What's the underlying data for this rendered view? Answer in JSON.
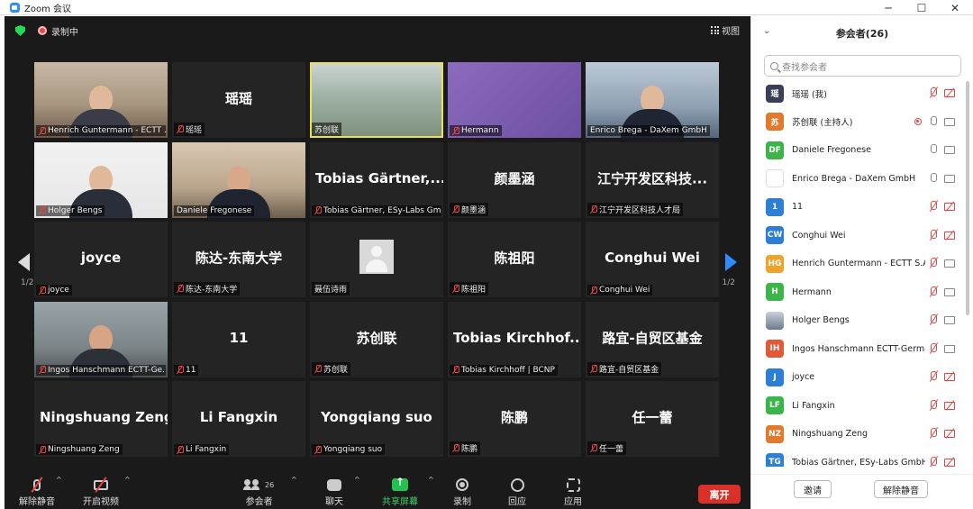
{
  "window": {
    "title": "Zoom 会议",
    "minimize": "─",
    "maximize": "☐",
    "close": "✕"
  },
  "topbar": {
    "recording_label": "录制中",
    "view_label": "视图"
  },
  "colors": {
    "accent": "#2d8cff",
    "leave": "#d9302a",
    "muted": "#e64545",
    "share": "#23c14f"
  },
  "grid": {
    "page_left": "1/2",
    "page_right": "1/2",
    "tiles": [
      {
        "label": "Henrich Guntermann - ECTT ...",
        "display": ""
      },
      {
        "label": "瑶瑶",
        "display": "瑶瑶"
      },
      {
        "label": "苏创联",
        "display": ""
      },
      {
        "label": "Hermann",
        "display": ""
      },
      {
        "label": "Enrico Brega - DaXem GmbH",
        "display": ""
      },
      {
        "label": "Holger Bengs",
        "display": ""
      },
      {
        "label": "Daniele Fregonese",
        "display": ""
      },
      {
        "label": "Tobias Gärtner, ESy-Labs Gm...",
        "display": "Tobias Gärtner,..."
      },
      {
        "label": "颜墨涵",
        "display": "颜墨涵"
      },
      {
        "label": "江宁开发区科技人才局",
        "display": "江宁开发区科技..."
      },
      {
        "label": "joyce",
        "display": "joyce"
      },
      {
        "label": "陈达-东南大学",
        "display": "陈达-东南大学"
      },
      {
        "label": "聂伍诗雨",
        "display": ""
      },
      {
        "label": "陈祖阳",
        "display": "陈祖阳"
      },
      {
        "label": "Conghui Wei",
        "display": "Conghui Wei"
      },
      {
        "label": "Ingos Hanschmann ECTT-Ge...",
        "display": ""
      },
      {
        "label": "11",
        "display": "11"
      },
      {
        "label": "苏创联",
        "display": "苏创联"
      },
      {
        "label": "Tobias Kirchhoff | BCNP",
        "display": "Tobias Kirchhof..."
      },
      {
        "label": "路宜-自贸区基金",
        "display": "路宜-自贸区基金"
      },
      {
        "label": "Ningshuang Zeng",
        "display": "Ningshuang Zeng"
      },
      {
        "label": "Li Fangxin",
        "display": "Li Fangxin"
      },
      {
        "label": "Yongqiang suo",
        "display": "Yongqiang suo"
      },
      {
        "label": "陈鹏",
        "display": "陈鹏"
      },
      {
        "label": "任一蕾",
        "display": "任一蕾"
      }
    ]
  },
  "toolbar": {
    "unmute": "解除静音",
    "start_video": "开启视频",
    "participants": "参会者",
    "participants_count": "26",
    "chat": "聊天",
    "share_screen": "共享屏幕",
    "record": "录制",
    "reactions": "回应",
    "apps": "应用",
    "leave": "离开",
    "caret": "^"
  },
  "panel": {
    "collapse": "⌄",
    "title": "参会者(26)",
    "search_placeholder": "查找参会者",
    "invite": "邀请",
    "unmute_me": "解除静音",
    "participants": [
      {
        "avatar": "瑶",
        "color": "#3a3f55",
        "name": "瑶瑶 (我)",
        "mic": "off",
        "cam": "off",
        "rec": false
      },
      {
        "avatar": "苏",
        "color": "#e07a2e",
        "name": "苏创联 (主持人)",
        "mic": "on",
        "cam": "on",
        "rec": true
      },
      {
        "avatar": "DF",
        "color": "#3bb54a",
        "name": "Daniele Fregonese",
        "mic": "on",
        "cam": "on",
        "rec": false
      },
      {
        "avatar": "",
        "color": "#ffffff",
        "name": "Enrico Brega - DaXem GmbH",
        "mic": "on",
        "cam": "on",
        "rec": false
      },
      {
        "avatar": "1",
        "color": "#2d7fd6",
        "name": "11",
        "mic": "off",
        "cam": "off",
        "rec": false
      },
      {
        "avatar": "CW",
        "color": "#2d7fd6",
        "name": "Conghui Wei",
        "mic": "off",
        "cam": "off",
        "rec": false
      },
      {
        "avatar": "HG",
        "color": "#f0a32a",
        "name": "Henrich Guntermann - ECTT S.A.",
        "mic": "off",
        "cam": "on",
        "rec": false
      },
      {
        "avatar": "H",
        "color": "#3bb54a",
        "name": "Hermann",
        "mic": "off",
        "cam": "on",
        "rec": false
      },
      {
        "avatar": "",
        "color": "#7a8aa0",
        "name": "Holger Bengs",
        "mic": "off",
        "cam": "on",
        "rec": false
      },
      {
        "avatar": "IH",
        "color": "#e05a3a",
        "name": "Ingos Hanschmann ECTT-Germa...",
        "mic": "off",
        "cam": "on",
        "rec": false
      },
      {
        "avatar": "J",
        "color": "#2d7fd6",
        "name": "joyce",
        "mic": "off",
        "cam": "off",
        "rec": false
      },
      {
        "avatar": "LF",
        "color": "#3bb54a",
        "name": "Li Fangxin",
        "mic": "off",
        "cam": "off",
        "rec": false
      },
      {
        "avatar": "NZ",
        "color": "#e07a2e",
        "name": "Ningshuang Zeng",
        "mic": "off",
        "cam": "off",
        "rec": false
      },
      {
        "avatar": "TG",
        "color": "#2d7fd6",
        "name": "Tobias Gärtner, ESy-Labs GmbH",
        "mic": "off",
        "cam": "off",
        "rec": false
      }
    ]
  }
}
